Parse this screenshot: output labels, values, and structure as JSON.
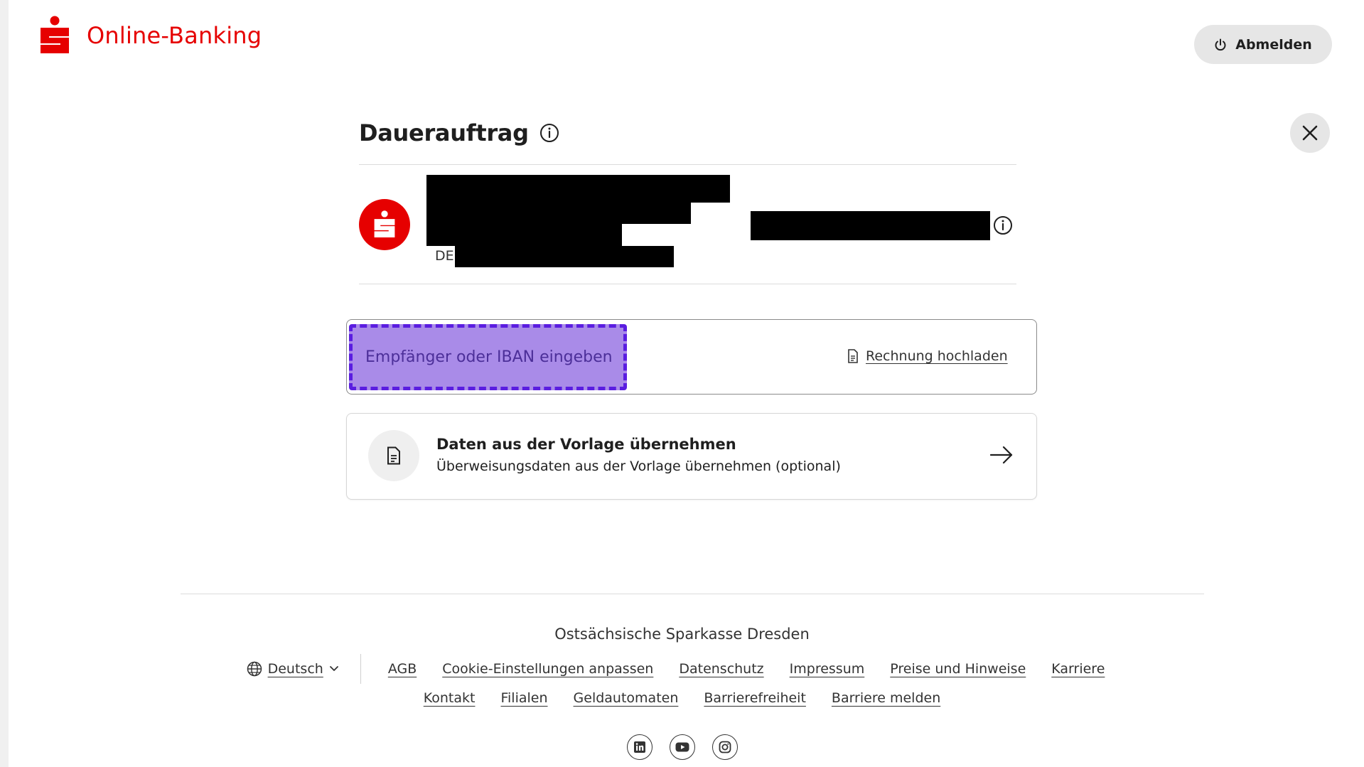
{
  "header": {
    "brand_title": "Online-Banking",
    "logout_label": "Abmelden"
  },
  "main": {
    "title": "Dauerauftrag",
    "account": {
      "iban_prefix": "DE"
    },
    "recipient": {
      "placeholder": "Empfänger oder IBAN eingeben",
      "upload_label": "Rechnung hochladen"
    },
    "template_card": {
      "title": "Daten aus der Vorlage übernehmen",
      "subtitle": "Überweisungsdaten aus der Vorlage übernehmen (optional)"
    }
  },
  "footer": {
    "bank_name": "Ostsächsische Sparkasse Dresden",
    "language": "Deutsch",
    "links_row1": [
      "AGB",
      "Cookie-Einstellungen anpassen",
      "Datenschutz",
      "Impressum",
      "Preise und Hinweise",
      "Karriere"
    ],
    "links_row2": [
      "Kontakt",
      "Filialen",
      "Geldautomaten",
      "Barrierefreiheit",
      "Barriere melden"
    ],
    "socials": [
      "linkedin-icon",
      "youtube-icon",
      "instagram-icon"
    ]
  },
  "colors": {
    "brand_red": "#e60000",
    "highlight_fill": "#a98be8",
    "highlight_border": "#5a1de0"
  }
}
